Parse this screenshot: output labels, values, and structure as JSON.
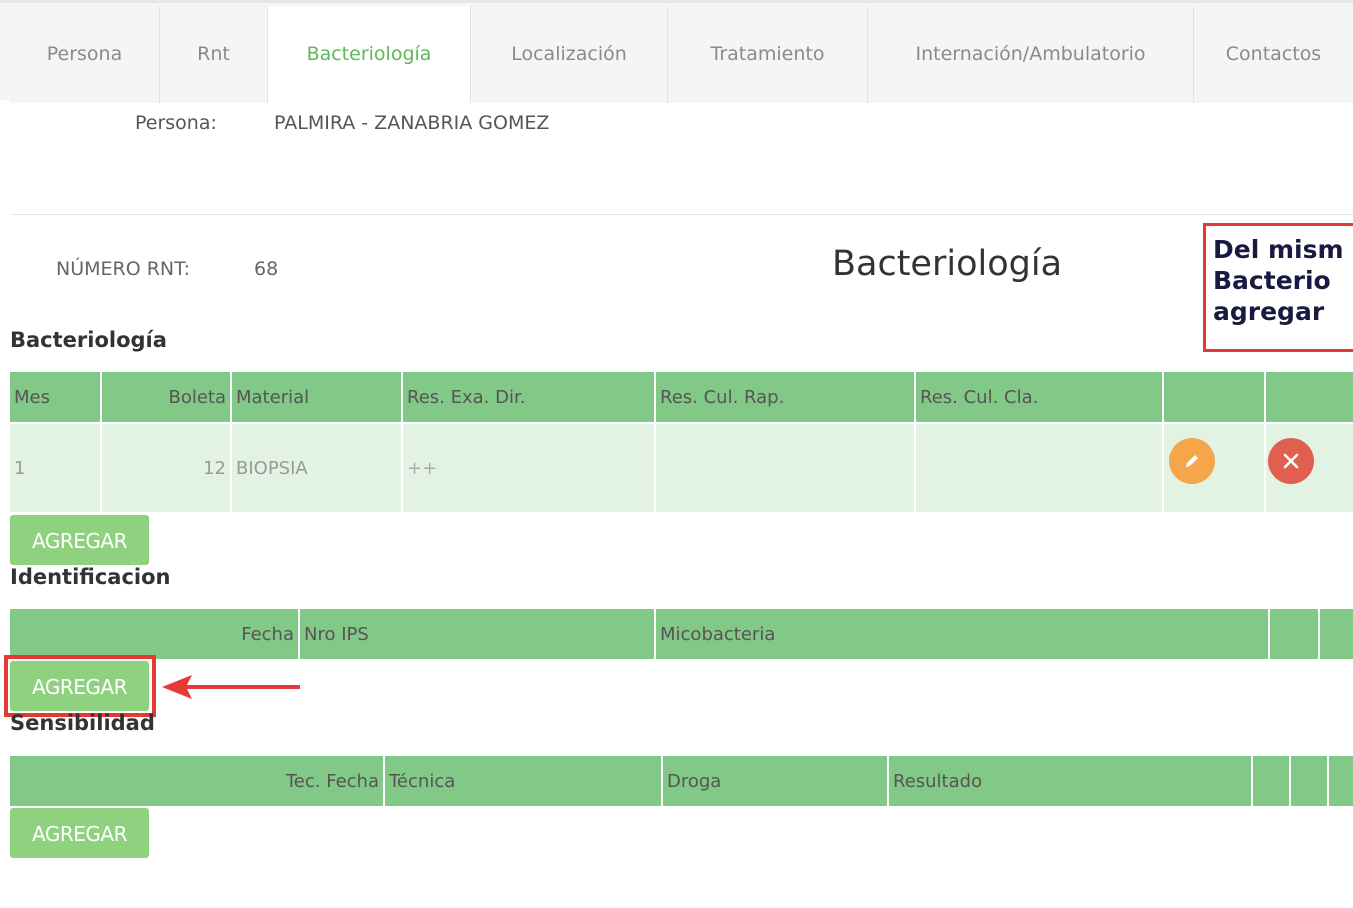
{
  "tabs": [
    "Persona",
    "Rnt",
    "Bacteriología",
    "Localización",
    "Tratamiento",
    "Internación/Ambulatorio",
    "Contactos"
  ],
  "active_tab": "Bacteriología",
  "persona": {
    "label": "Persona:",
    "value": "PALMIRA - ZANABRIA GOMEZ"
  },
  "rnt": {
    "label": "NÚMERO RNT:",
    "value": "68"
  },
  "page_title": "Bacteriología",
  "annotation": {
    "lines": [
      "Del mism",
      "Bacterio",
      "agregar "
    ]
  },
  "bacteriologia": {
    "title": "Bacteriología",
    "headers": [
      "Mes",
      "Boleta",
      "Material",
      "Res. Exa. Dir.",
      "Res. Cul. Rap.",
      "Res. Cul. Cla.",
      "",
      ""
    ],
    "rows": [
      {
        "mes": "1",
        "boleta": "12",
        "material": "BIOPSIA",
        "res_exa_dir": "++",
        "res_cul_rap": "",
        "res_cul_cla": ""
      }
    ],
    "add_label": "AGREGAR"
  },
  "identificacion": {
    "title": "Identificacion",
    "headers": [
      "Fecha",
      "Nro IPS",
      "Micobacteria",
      "",
      ""
    ],
    "add_label": "AGREGAR"
  },
  "sensibilidad": {
    "title": "Sensibilidad",
    "headers": [
      "Tec. Fecha",
      "Técnica",
      "Droga",
      "Resultado",
      "",
      "",
      ""
    ],
    "add_label": "AGREGAR"
  },
  "colors": {
    "header_green": "#82c887",
    "row_green": "#e2f3e3",
    "button_green": "#8ed17f",
    "accent_green": "#5cb85c",
    "edit_orange": "#f5a64a",
    "delete_red": "#e0604f",
    "annotation_red": "#e53935"
  },
  "icons": {
    "edit": "pencil-icon",
    "delete": "close-icon",
    "arrow": "arrow-left-icon"
  }
}
